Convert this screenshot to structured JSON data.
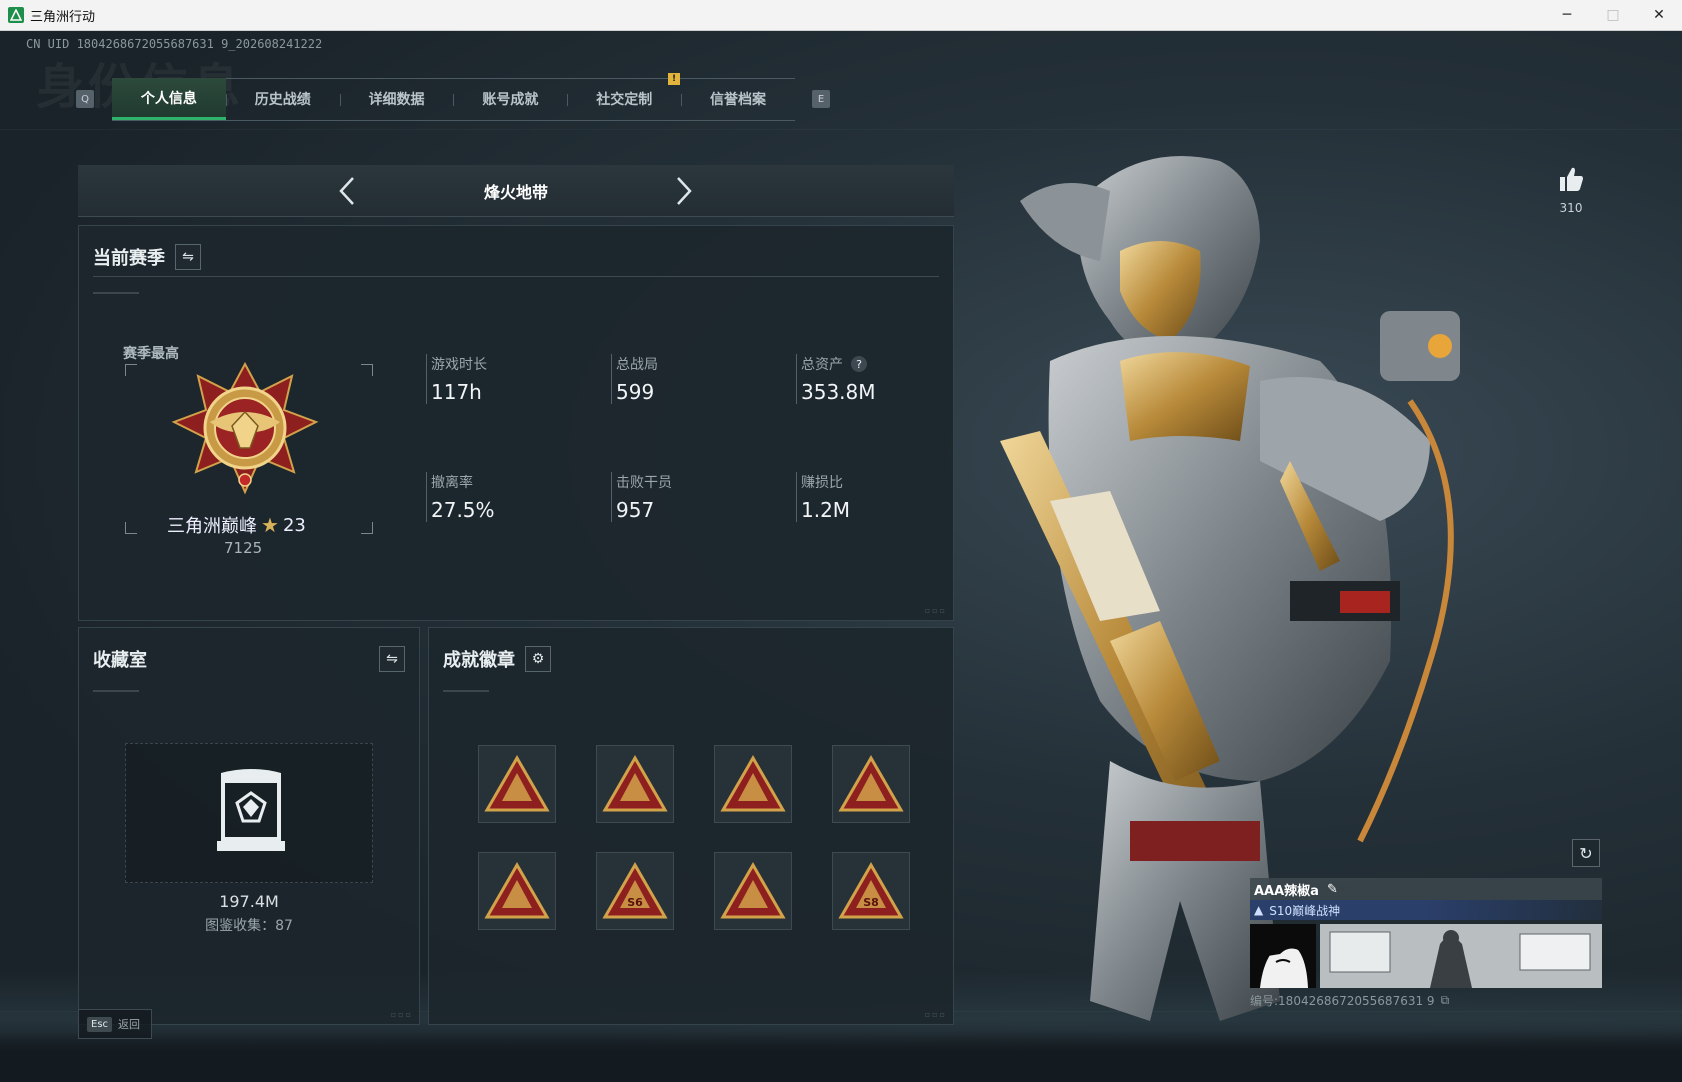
{
  "window": {
    "title": "三角洲行动",
    "minimize": "─",
    "maximize": "□",
    "close": "✕"
  },
  "watermark": "身份信息",
  "uid_line": "CN UID 1804268672055687631 9_202608241222",
  "key_hints": {
    "left": "Q",
    "right": "E"
  },
  "tabs": [
    {
      "label": "个人信息",
      "active": true
    },
    {
      "label": "历史战绩",
      "active": false
    },
    {
      "label": "详细数据",
      "active": false
    },
    {
      "label": "账号成就",
      "active": false
    },
    {
      "label": "社交定制",
      "active": false
    },
    {
      "label": "信誉档案",
      "active": false
    }
  ],
  "tab_alert": "!",
  "mode": {
    "title": "烽火地带"
  },
  "season": {
    "title": "当前赛季",
    "peak_label": "赛季最高",
    "rank_name": "三角洲巅峰",
    "rank_star": "★",
    "rank_stars": "23",
    "rank_points": "7125",
    "stats": [
      {
        "label": "游戏时长",
        "value": "117h"
      },
      {
        "label": "总战局",
        "value": "599"
      },
      {
        "label": "总资产",
        "value": "353.8M",
        "help": "?"
      },
      {
        "label": "撤离率",
        "value": "27.5%"
      },
      {
        "label": "击败干员",
        "value": "957"
      },
      {
        "label": "赚损比",
        "value": "1.2M"
      }
    ]
  },
  "collection": {
    "title": "收藏室",
    "value": "197.4M",
    "count_text": "图鉴收集：87"
  },
  "achievements": {
    "title": "成就徽章",
    "badges": [
      {
        "icon": "crate-badge-icon"
      },
      {
        "icon": "rocket-badge-icon"
      },
      {
        "icon": "soldier-badge-icon"
      },
      {
        "icon": "squad-badge-icon"
      },
      {
        "icon": "helmet-badge-icon"
      },
      {
        "icon": "s6-badge-icon",
        "label": "S6"
      },
      {
        "icon": "shield-badge-icon"
      },
      {
        "icon": "s8-badge-icon",
        "label": "S8"
      }
    ]
  },
  "like": {
    "count": "310"
  },
  "player": {
    "name": "AAA辣椒a",
    "title": "S10巅峰战神",
    "id_text": "编号:1804268672055687631 9"
  },
  "footer": {
    "esc_key": "Esc",
    "esc_label": "返回"
  },
  "colors": {
    "accent_green": "#2fb36a",
    "alert_yellow": "#e3b43b",
    "badge_red": "#8e1f1f",
    "badge_gold": "#d2a24a"
  }
}
